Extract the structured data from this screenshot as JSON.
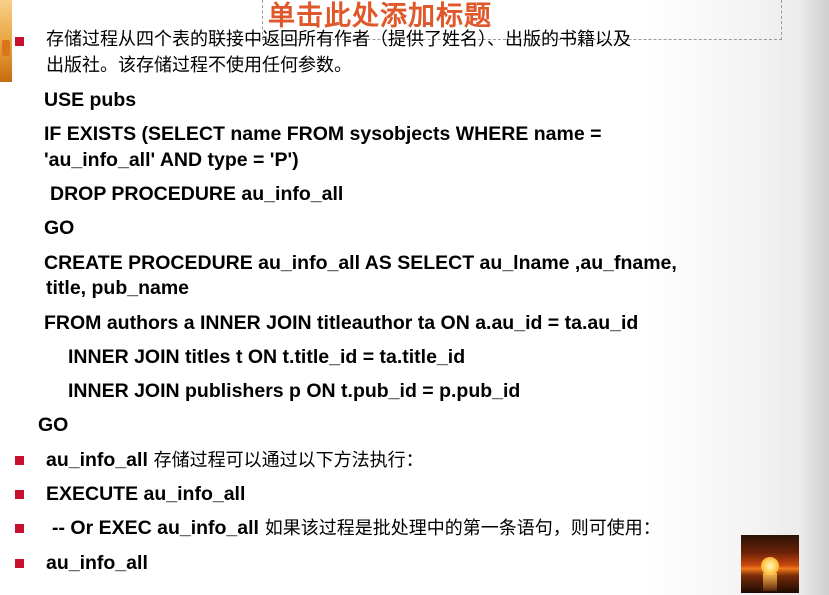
{
  "title": "单击此处添加标题",
  "intro": {
    "line1": "存储过程从四个表的联接中返回所有作者（提供了姓名）、出版的书籍以及",
    "line2": "出版社。该存储过程不使用任何参数。"
  },
  "code": {
    "l1": "USE pubs",
    "l2": "IF EXISTS (SELECT name FROM sysobjects WHERE name =",
    "l3": "'au_info_all' AND type = 'P')",
    "l4": "DROP PROCEDURE au_info_all",
    "l5": "GO",
    "l6": "CREATE PROCEDURE au_info_all AS SELECT au_lname ,au_fname,",
    "l7": "title,  pub_name",
    "l8": "FROM authors a INNER JOIN titleauthor ta ON a.au_id = ta.au_id",
    "l9": "INNER JOIN titles t ON t.title_id = ta.title_id",
    "l10": "INNER JOIN publishers p ON t.pub_id = p.pub_id",
    "l11": "GO"
  },
  "bullets": {
    "b2_code": "au_info_all",
    "b2_text": " 存储过程可以通过以下方法执行：",
    "b3": "EXECUTE au_info_all",
    "b4_code": "-- Or EXEC au_info_all",
    "b4_text": " 如果该过程是批处理中的第一条语句，则可使用：",
    "b5": "au_info_all"
  },
  "colors": {
    "title": "#e0572a",
    "bullet": "#c8102e"
  },
  "decor": {
    "top_left_accent": "orange-gradient-bar",
    "bottom_right_image": "sunset-image"
  }
}
